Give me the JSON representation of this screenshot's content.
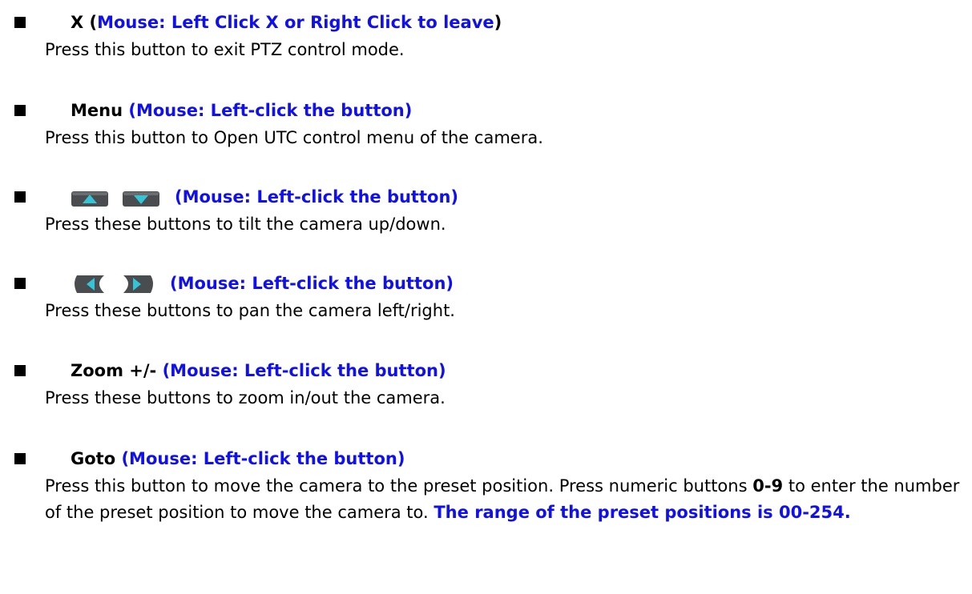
{
  "items": [
    {
      "id": "x",
      "title_bold": "X (",
      "title_blue": "Mouse: Left Click X or Right Click to leave",
      "title_end": ")",
      "description": "Press this button to exit PTZ control mode."
    },
    {
      "id": "menu",
      "title_bold": "Menu ",
      "title_blue": "(Mouse: Left-click the button)",
      "description": "Press this button to Open UTC control menu of the camera."
    },
    {
      "id": "tilt",
      "icons": [
        "tilt-up-icon",
        "tilt-down-icon"
      ],
      "title_blue": "(Mouse: Left-click the button)",
      "description": "Press these buttons to tilt the camera up/down."
    },
    {
      "id": "pan",
      "icons": [
        "pan-left-icon",
        "pan-right-icon"
      ],
      "title_blue": "(Mouse: Left-click the button)",
      "description": "Press these buttons to pan the camera left/right."
    },
    {
      "id": "zoom",
      "title_bold": "Zoom +/- ",
      "title_blue": "(Mouse: Left-click the button)",
      "description": "Press these buttons to zoom in/out the camera."
    },
    {
      "id": "goto",
      "title_bold": "Goto ",
      "title_blue": "(Mouse: Left-click the button)",
      "description_part1": "Press this button to move the camera to the preset position.   Press numeric buttons ",
      "description_bold": "0-9",
      "description_part2": " to enter the number of the preset position to move the camera to.   ",
      "description_blue": "The range of the preset positions is 00-254."
    }
  ],
  "colors": {
    "accent_blue": "#1010ee",
    "text": "#000000",
    "icon_body": "#4a4d50",
    "icon_arrow": "#35c3d6"
  }
}
